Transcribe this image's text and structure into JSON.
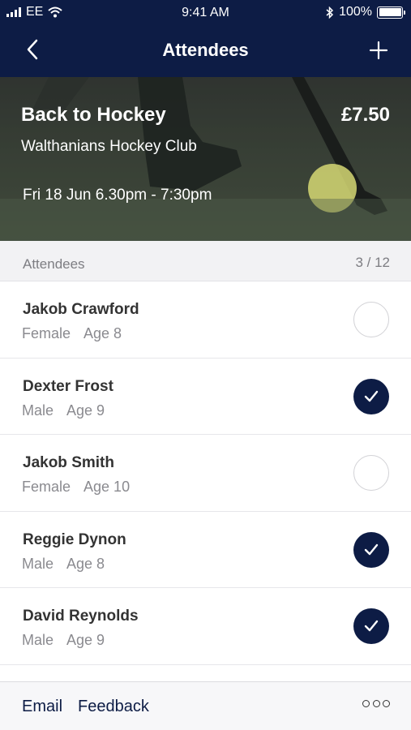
{
  "status": {
    "carrier": "EE",
    "time": "9:41 AM",
    "battery": "100%"
  },
  "nav": {
    "title": "Attendees"
  },
  "event": {
    "title": "Back to Hockey",
    "price": "£7.50",
    "club": "Walthanians Hockey Club",
    "when": "Fri 18 Jun 6.30pm - 7:30pm"
  },
  "section": {
    "label": "Attendees",
    "count": "3 / 12"
  },
  "attendees": [
    {
      "name": "Jakob Crawford",
      "gender": "Female",
      "age": "Age 8",
      "checked": false
    },
    {
      "name": "Dexter Frost",
      "gender": "Male",
      "age": "Age 9",
      "checked": true
    },
    {
      "name": "Jakob Smith",
      "gender": "Female",
      "age": "Age 10",
      "checked": false
    },
    {
      "name": "Reggie Dynon",
      "gender": "Male",
      "age": "Age 8",
      "checked": true
    },
    {
      "name": "David Reynolds",
      "gender": "Male",
      "age": "Age 9",
      "checked": true
    }
  ],
  "footer": {
    "email": "Email",
    "feedback": "Feedback"
  },
  "colors": {
    "brand": "#0d1c45",
    "background": "#ffffff",
    "section": "#f2f2f4"
  },
  "icons": [
    "back-chevron-icon",
    "plus-icon",
    "checkmark-icon",
    "more-dots-icon",
    "wifi-icon",
    "bluetooth-icon",
    "battery-icon",
    "signal-icon"
  ]
}
